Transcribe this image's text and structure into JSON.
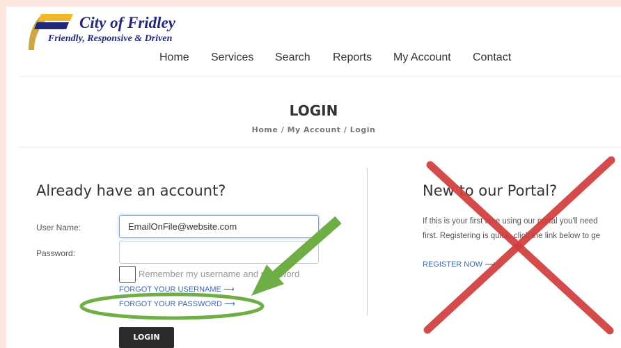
{
  "header": {
    "logo_title": "City of Fridley",
    "logo_tagline": "Friendly, Responsive & Driven"
  },
  "nav": {
    "items": [
      {
        "label": "Home"
      },
      {
        "label": "Services"
      },
      {
        "label": "Search"
      },
      {
        "label": "Reports"
      },
      {
        "label": "My Account"
      },
      {
        "label": "Contact"
      }
    ]
  },
  "page_title": "LOGIN",
  "breadcrumb": {
    "home": "Home",
    "account": "My Account",
    "current": "Login",
    "separator": "/"
  },
  "login_form": {
    "heading": "Already have an account?",
    "username_label": "User Name:",
    "username_value": "EmailOnFile@website.com",
    "password_label": "Password:",
    "password_value": "",
    "remember_label": "Remember my username and password",
    "forgot_username": "FORGOT YOUR USERNAME ⟶",
    "forgot_password": "FORGOT YOUR PASSWORD ⟶",
    "submit_label": "LOGIN"
  },
  "register": {
    "heading": "New to our Portal?",
    "line1": "If this is your first time using our portal you'll need",
    "line2": "first. Registering is quick, click the link below to ge",
    "link": "REGISTER NOW ⟶"
  },
  "annotations": {
    "arrow_color": "#6fae46",
    "ellipse_color": "#6fae46",
    "x_color": "#d13c3c",
    "arrow_icon": "green-arrow-icon",
    "highlight": "green-ellipse-highlight",
    "cross_icon": "red-x-icon"
  }
}
